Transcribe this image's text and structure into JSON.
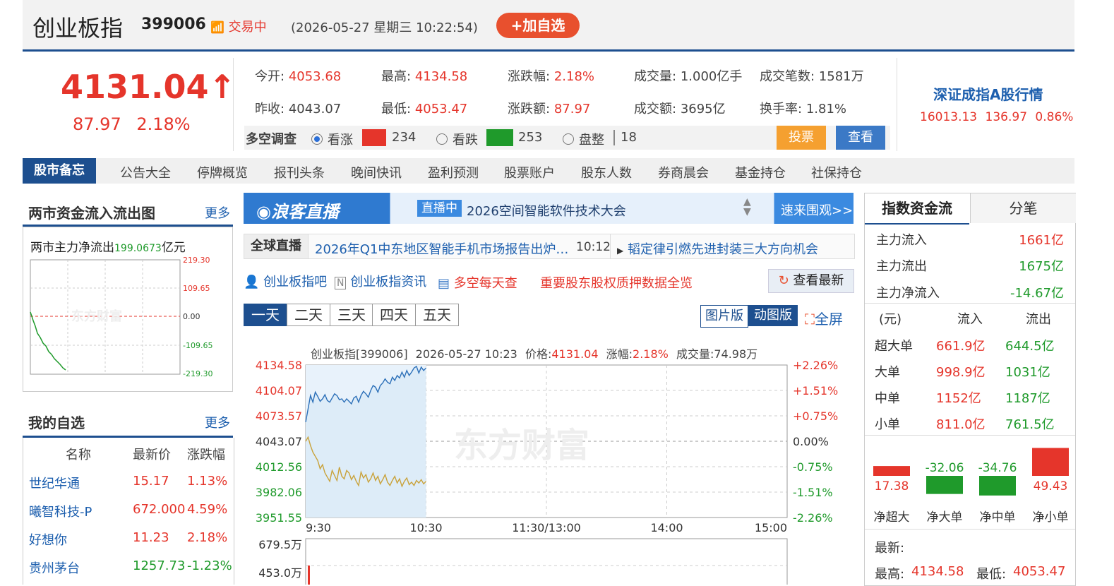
{
  "header": {
    "name": "创业板指",
    "code": "399006",
    "trading_status": "交易中",
    "datetime": "(2026-05-27 星期三 10:22:54)",
    "add_watch": "+加自选"
  },
  "quote": {
    "price": "4131.04",
    "arrow": "↑",
    "change": "87.97",
    "change_pct": "2.18%",
    "open_label": "今开:",
    "open": "4053.68",
    "high_label": "最高:",
    "high": "4134.58",
    "pct_label": "涨跌幅:",
    "pct": "2.18%",
    "vol_label": "成交量:",
    "vol": "1.000亿手",
    "count_label": "成交笔数:",
    "count": "1581万",
    "prev_label": "昨收:",
    "prev": "4043.07",
    "low_label": "最低:",
    "low": "4053.47",
    "amt_chg_label": "涨跌额:",
    "amt_chg": "87.97",
    "turnover_label": "成交额:",
    "turnover": "3695亿",
    "rate_label": "换手率:",
    "rate": "1.81%"
  },
  "vote": {
    "label": "多空调查",
    "bull": "看涨",
    "bull_count": "234",
    "bear": "看跌",
    "bear_count": "253",
    "flat": "盘整",
    "flat_count": "18",
    "vote_btn": "投票",
    "view_btn": "查看"
  },
  "index_side": {
    "title": "深证成指A股行情",
    "value": "16013.13",
    "change": "136.97",
    "pct": "0.86%"
  },
  "nav": {
    "active": "股市备忘",
    "items": [
      "公告大全",
      "停牌概览",
      "报刊头条",
      "晚间快讯",
      "盈利预测",
      "股票账户",
      "股东人数",
      "券商晨会",
      "基金持仓",
      "社保持仓"
    ]
  },
  "flow_panel": {
    "title": "两市资金流入流出图",
    "more": "更多",
    "subtitle": "两市主力净流出",
    "amount": "199.0673",
    "unit": "亿元",
    "yticks": [
      "219.30",
      "109.65",
      "0.00",
      "-109.65",
      "-219.30"
    ],
    "watermark": "东方财富"
  },
  "watchlist": {
    "title": "我的自选",
    "more": "更多",
    "headers": [
      "名称",
      "最新价",
      "涨跌幅"
    ],
    "rows": [
      {
        "name": "世纪华通",
        "price": "15.17",
        "pct": "1.13%",
        "dir": "up"
      },
      {
        "name": "曦智科技-P",
        "price": "672.000",
        "pct": "4.59%",
        "dir": "up"
      },
      {
        "name": "好想你",
        "price": "11.23",
        "pct": "2.18%",
        "dir": "up"
      },
      {
        "name": "贵州茅台",
        "price": "1257.73",
        "pct": "-1.23%",
        "dir": "down"
      }
    ]
  },
  "live": {
    "logo": "浪客直播",
    "badge": "直播中",
    "title": "2026空间智能软件技术大会",
    "cta": "速来围观>>"
  },
  "global": {
    "label": "全球直播",
    "headline": "2026年Q1中东地区智能手机市场报告出炉…",
    "time": "10:12",
    "headline2": "韬定律引燃先进封装三大方向机会"
  },
  "links": {
    "bar": "创业板指吧",
    "news": "创业板指资讯",
    "daily": "多空每天查",
    "pledge": "重要股东股权质押数据全览",
    "refresh": "查看最新"
  },
  "chart_tabs": [
    "一天",
    "二天",
    "三天",
    "四天",
    "五天"
  ],
  "chart_modes": {
    "pic": "图片版",
    "dyn": "动图版",
    "full": "全屏"
  },
  "chart_info": {
    "name": "创业板指[399006]",
    "datetime": "2026-05-27 10:23",
    "price_label": "价格:",
    "price": "4131.04",
    "pct_label": "涨幅:",
    "pct": "2.18%",
    "vol_label": "成交量:",
    "vol": "74.98万"
  },
  "chart_data": {
    "type": "line",
    "x_ticks": [
      "9:30",
      "10:30",
      "11:30/13:00",
      "14:00",
      "15:00"
    ],
    "y_left": [
      "4134.58",
      "4104.07",
      "4073.57",
      "4043.07",
      "4012.56",
      "3982.06",
      "3951.55"
    ],
    "y_right": [
      "+2.26%",
      "+1.51%",
      "+0.75%",
      "0.00%",
      "-0.75%",
      "-1.51%",
      "-2.26%"
    ],
    "ylim": [
      3951.55,
      4134.58
    ],
    "prev_close": 4043.07,
    "vol_ticks": [
      "679.5万",
      "453.0万"
    ],
    "watermark": "东方财富",
    "series": [
      {
        "name": "价格",
        "color": "#2b6fb8",
        "values": [
          4066,
          4082,
          4098,
          4090,
          4102,
          4097,
          4091,
          4094,
          4099,
          4092,
          4090,
          4095,
          4100,
          4098,
          4093,
          4094,
          4090,
          4094,
          4091,
          4088,
          4095,
          4097,
          4090,
          4098,
          4103,
          4100,
          4096,
          4104,
          4110,
          4108,
          4102,
          4110,
          4113,
          4118,
          4114,
          4112,
          4120,
          4116,
          4122,
          4119,
          4126,
          4120,
          4128,
          4122,
          4126,
          4131,
          4133,
          4125,
          4132,
          4128,
          4131
        ]
      },
      {
        "values": [
          4043,
          4048,
          4038,
          4030,
          4025,
          4020,
          4010,
          4015,
          4005,
          4000,
          3995,
          4008,
          4002,
          3996,
          4012,
          4001,
          3998,
          4008,
          4005,
          3997,
          4002,
          3995,
          3990,
          4006,
          3999,
          4003,
          3994,
          3998,
          4005,
          3996,
          4001,
          3992,
          3997,
          4003,
          3994,
          3990,
          3996,
          4001,
          3993,
          3998,
          3989,
          3995,
          3999,
          3991,
          3994,
          3990,
          3996,
          3993,
          3997,
          3992,
          3995
        ],
        "color": "#c9a23a"
      }
    ]
  },
  "right_panel": {
    "tab1": "指数资金流",
    "tab2": "分笔",
    "main_in_label": "主力流入",
    "main_in": "1661亿",
    "main_out_label": "主力流出",
    "main_out": "1675亿",
    "main_net_label": "主力净流入",
    "main_net": "-14.67亿",
    "table_headers": [
      "(元)",
      "流入",
      "流出"
    ],
    "rows": [
      {
        "label": "超大单",
        "in": "661.9亿",
        "out": "644.5亿"
      },
      {
        "label": "大单",
        "in": "998.9亿",
        "out": "1031亿"
      },
      {
        "label": "中单",
        "in": "1152亿",
        "out": "1187亿"
      },
      {
        "label": "小单",
        "in": "811.0亿",
        "out": "761.5亿"
      }
    ],
    "bars": [
      {
        "label": "净超大",
        "value": 17.38,
        "text": "17.38"
      },
      {
        "label": "净大单",
        "value": -32.06,
        "text": "-32.06"
      },
      {
        "label": "净中单",
        "value": -34.76,
        "text": "-34.76"
      },
      {
        "label": "净小单",
        "value": 49.43,
        "text": "49.43"
      }
    ],
    "latest_label": "最新:",
    "high_label": "最高:",
    "high": "4134.58",
    "low_label": "最低:",
    "low": "4053.47"
  }
}
